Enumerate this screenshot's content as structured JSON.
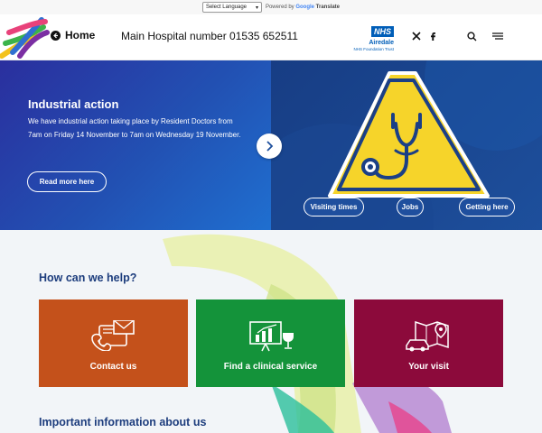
{
  "translate": {
    "select_label": "Select Language",
    "powered_by": "Powered by",
    "google": "Google",
    "translate_word": "Translate"
  },
  "header": {
    "home_label": "Home",
    "phone_text": "Main Hospital number 01535 652511",
    "nhs": {
      "mark": "NHS",
      "name": "Airedale",
      "trust": "NHS Foundation Trust"
    }
  },
  "hero": {
    "title": "Industrial action",
    "text": "We have industrial action taking place by Resident Doctors from 7am on Friday 14 November to 7am on Wednesday 19 November.",
    "read_more_label": "Read more here",
    "quick_links": [
      "Visiting times",
      "Jobs",
      "Getting here"
    ]
  },
  "help": {
    "title": "How can we help?",
    "cards": [
      {
        "label": "Contact us",
        "icon": "contact-icon",
        "color": "#c4511b"
      },
      {
        "label": "Find a clinical service",
        "icon": "clinical-service-icon",
        "color": "#14933a"
      },
      {
        "label": "Your visit",
        "icon": "map-car-icon",
        "color": "#8c0a3b"
      }
    ]
  },
  "important": {
    "title": "Important information about us"
  },
  "colors": {
    "nhs_blue": "#005eb8",
    "heading_blue": "#1d3d7d",
    "hero_blue": "#2251b3",
    "warning_yellow": "#f6d42a"
  }
}
